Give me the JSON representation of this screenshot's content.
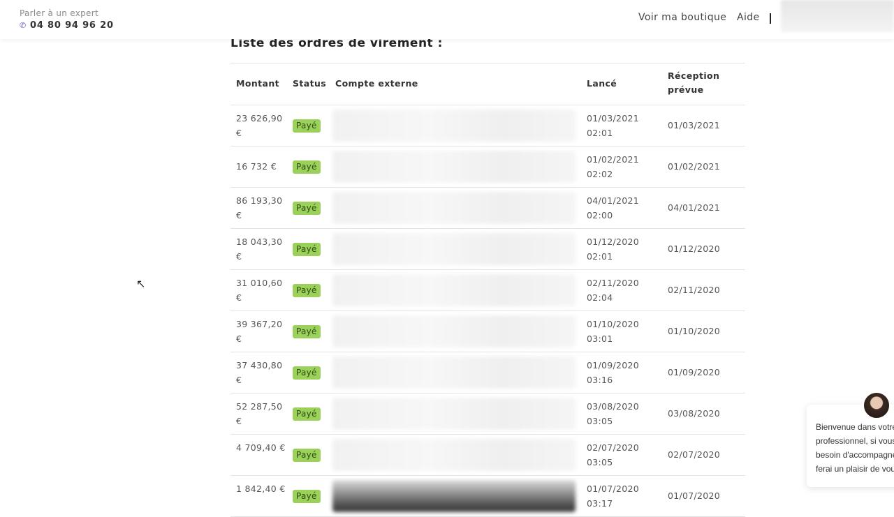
{
  "header": {
    "expert_label": "Parler à un expert",
    "phone": "04 80 94 96 20",
    "nav_shop": "Voir ma boutique",
    "nav_help": "Aide"
  },
  "section_title": "Liste des ordres de virement :",
  "table": {
    "headers": {
      "amount": "Montant",
      "status": "Status",
      "account": "Compte externe",
      "launched": "Lancé",
      "reception_line1": "Réception",
      "reception_line2": "prévue"
    },
    "rows": [
      {
        "amount": "23 626,90 €",
        "status": "Payé",
        "launched": "01/03/2021 02:01",
        "reception": "01/03/2021"
      },
      {
        "amount": "16 732 €",
        "status": "Payé",
        "launched": "01/02/2021 02:02",
        "reception": "01/02/2021"
      },
      {
        "amount": "86 193,30 €",
        "status": "Payé",
        "launched": "04/01/2021 02:00",
        "reception": "04/01/2021"
      },
      {
        "amount": "18 043,30 €",
        "status": "Payé",
        "launched": "01/12/2020 02:01",
        "reception": "01/12/2020"
      },
      {
        "amount": "31 010,60 €",
        "status": "Payé",
        "launched": "02/11/2020 02:04",
        "reception": "02/11/2020"
      },
      {
        "amount": "39 367,20 €",
        "status": "Payé",
        "launched": "01/10/2020 03:01",
        "reception": "01/10/2020"
      },
      {
        "amount": "37 430,80 €",
        "status": "Payé",
        "launched": "01/09/2020 03:16",
        "reception": "01/09/2020"
      },
      {
        "amount": "52 287,50 €",
        "status": "Payé",
        "launched": "03/08/2020 03:05",
        "reception": "03/08/2020"
      },
      {
        "amount": "4 709,40 €",
        "status": "Payé",
        "launched": "02/07/2020 03:05",
        "reception": "02/07/2020"
      },
      {
        "amount": "1 842,40 €",
        "status": "Payé",
        "launched": "01/07/2020 03:17",
        "reception": "01/07/2020"
      }
    ]
  },
  "chat": {
    "line1": "Bienvenue dans votre",
    "line2": "professionnel, si vous",
    "line3": "besoin d'accompagne",
    "line4": "ferai un plaisir de vous"
  },
  "colors": {
    "badge": "#9bd15a",
    "phone_icon": "#5b4fb3"
  },
  "icons": {
    "phone": "phone-icon",
    "cursor": "cursor-icon"
  }
}
